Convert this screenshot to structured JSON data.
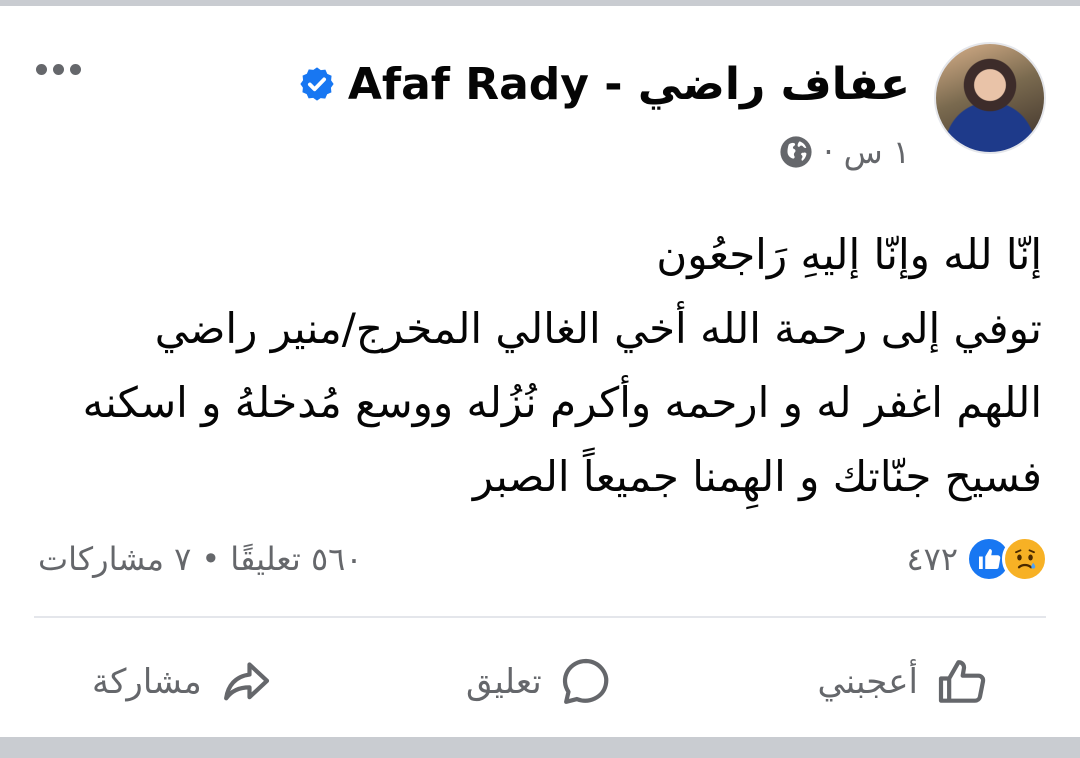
{
  "post": {
    "author": "Afaf Rady - عفاف راضي",
    "timestamp": "١ س",
    "separator": "·",
    "lines": [
      "إنّا لله وإنّا إليهِ رَاجعُون",
      "توفي إلى رحمة الله أخي الغالي المخرج/منير راضي",
      "اللهم اغفر له و ارحمه وأكرم نُزُله ووسع مُدخلهُ و اسكنه",
      "فسيح جنّاتك و الهِمنا جميعاً الصبر"
    ]
  },
  "stats": {
    "reaction_count": "٤٧٢",
    "comments": "٥٦٠ تعليقًا",
    "dot": "•",
    "shares": "٧ مشاركات"
  },
  "actions": {
    "like": "أعجبني",
    "comment": "تعليق",
    "share": "مشاركة"
  },
  "icons": {
    "verified": "verified-badge-icon",
    "audience": "globe-icon",
    "more": "more-options-icon",
    "reactions": [
      "sad-reaction-icon",
      "like-reaction-icon"
    ]
  },
  "colors": {
    "accent": "#1877f2",
    "secondary_text": "#65676b",
    "sad_reaction": "#f7b125"
  }
}
